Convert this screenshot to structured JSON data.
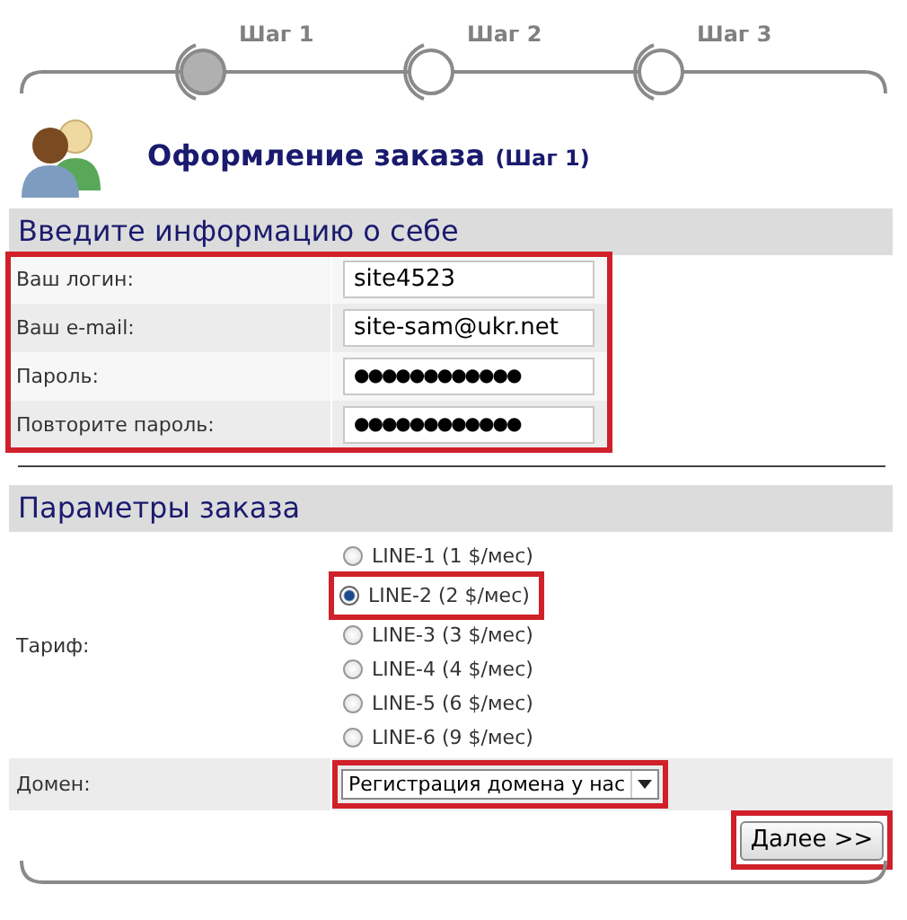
{
  "steps": [
    {
      "label": "Шаг 1",
      "selected": true
    },
    {
      "label": "Шаг 2",
      "selected": false
    },
    {
      "label": "Шаг 3",
      "selected": false
    }
  ],
  "heading": {
    "title": "Оформление заказа",
    "note": "(Шаг 1)"
  },
  "sections": [
    {
      "title": "Введите информацию о себе",
      "highlighted": true,
      "rows": [
        {
          "kind": "text",
          "label": "Ваш логин:",
          "value": "site4523"
        },
        {
          "kind": "text",
          "label": "Ваш e-mail:",
          "value": "site-sam@ukr.net"
        },
        {
          "kind": "text",
          "label": "Пароль:",
          "value": "●●●●●●●●●●●●"
        },
        {
          "kind": "text",
          "label": "Повторите пароль:",
          "value": "●●●●●●●●●●●●"
        }
      ]
    },
    {
      "title": "Параметры заказа",
      "highlighted": false,
      "rows": [
        {
          "kind": "radio",
          "label": "Тариф:",
          "options": [
            {
              "label": "LINE-1 (1 $/мес)",
              "selected": false,
              "highlighted": false
            },
            {
              "label": "LINE-2 (2 $/мес)",
              "selected": true,
              "highlighted": true
            },
            {
              "label": "LINE-3 (3 $/мес)",
              "selected": false,
              "highlighted": false
            },
            {
              "label": "LINE-4 (4 $/мес)",
              "selected": false,
              "highlighted": false
            },
            {
              "label": "LINE-5 (6 $/мес)",
              "selected": false,
              "highlighted": false
            },
            {
              "label": "LINE-6 (9 $/мес)",
              "selected": false,
              "highlighted": false
            }
          ]
        },
        {
          "kind": "select",
          "label": "Домен:",
          "value": "Регистрация домена у нас",
          "highlighted": true
        }
      ]
    }
  ],
  "next_button": {
    "label": "Далее >>",
    "highlighted": true
  }
}
